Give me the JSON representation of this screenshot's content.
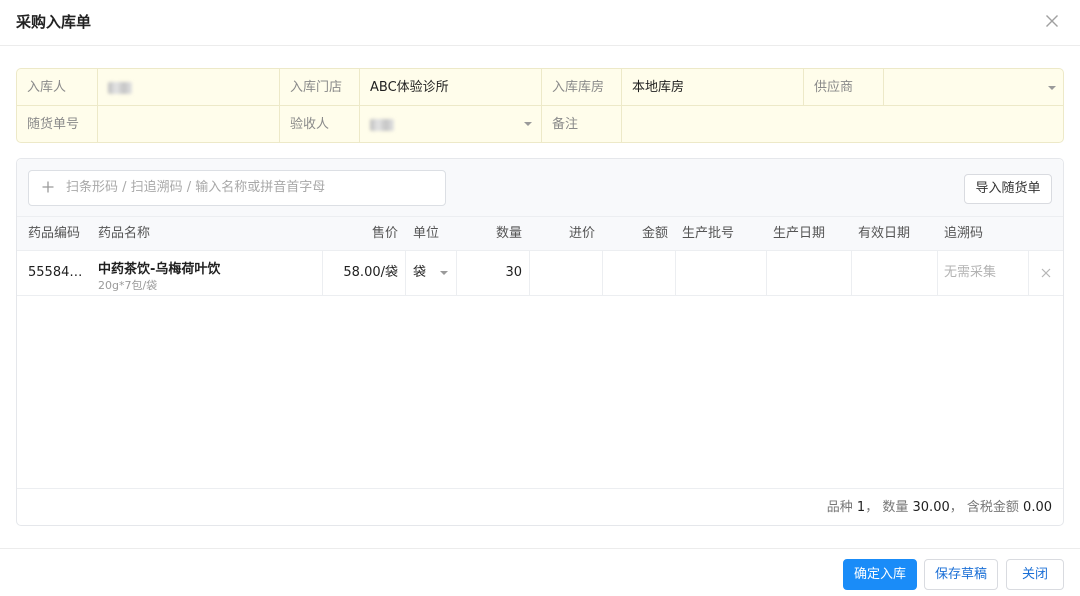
{
  "dialog": {
    "title": "采购入库单"
  },
  "form": {
    "receiver_label": "入库人",
    "store_label": "入库门店",
    "store_value": "ABC体验诊所",
    "warehouse_label": "入库库房",
    "warehouse_value": "本地库房",
    "supplier_label": "供应商",
    "supplier_value": "",
    "delivery_no_label": "随货单号",
    "delivery_no_value": "",
    "inspector_label": "验收人",
    "remark_label": "备注",
    "remark_value": ""
  },
  "search": {
    "placeholder": "扫条形码 / 扫追溯码 / 输入名称或拼音首字母"
  },
  "import_button": "导入随货单",
  "table": {
    "headers": {
      "code": "药品编码",
      "name": "药品名称",
      "price": "售价",
      "unit": "单位",
      "qty": "数量",
      "cost": "进价",
      "amount": "金额",
      "batch": "生产批号",
      "mfg_date": "生产日期",
      "exp_date": "有效日期",
      "trace": "追溯码"
    },
    "rows": [
      {
        "code": "55584…",
        "name": "中药茶饮-乌梅荷叶饮",
        "spec": "20g*7包/袋",
        "price": "58.00/袋",
        "unit": "袋",
        "qty": "30",
        "cost": "",
        "amount": "",
        "batch": "",
        "mfg_date": "",
        "exp_date": "",
        "trace": "无需采集"
      }
    ]
  },
  "summary": {
    "kinds_label": "品种",
    "kinds_value": "1",
    "sep1": "，",
    "qty_label": "数量",
    "qty_value": "30.00",
    "sep2": "，",
    "amount_label": "含税金额",
    "amount_value": "0.00"
  },
  "buttons": {
    "confirm": "确定入库",
    "draft": "保存草稿",
    "close": "关闭"
  },
  "colors": {
    "primary": "#1a8cf8",
    "form_bg": "#fffdeb",
    "header_bg": "#f8f9fb"
  }
}
